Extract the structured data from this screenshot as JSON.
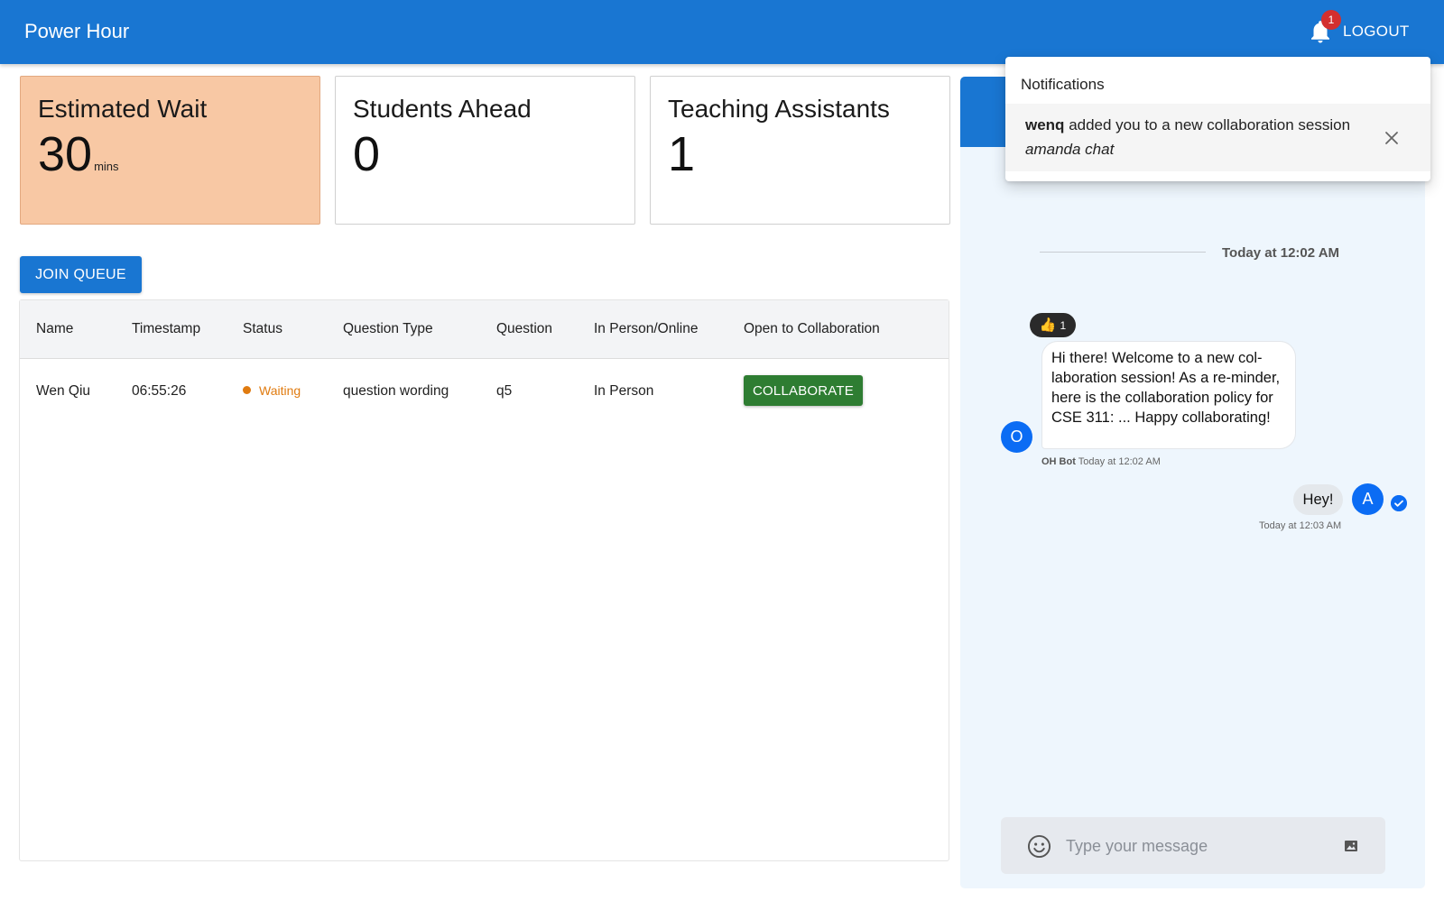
{
  "app": {
    "title": "Power Hour"
  },
  "header": {
    "notification_count": "1",
    "logout_label": "LOGOUT"
  },
  "stats": {
    "wait": {
      "title": "Estimated Wait",
      "value": "30",
      "unit": "mins"
    },
    "ahead": {
      "title": "Students Ahead",
      "value": "0"
    },
    "tas": {
      "title": "Teaching Assistants",
      "value": "1"
    }
  },
  "queue": {
    "join_label": "JOIN QUEUE",
    "columns": [
      "Name",
      "Timestamp",
      "Status",
      "Question Type",
      "Question",
      "In Person/Online",
      "Open to Collaboration"
    ],
    "rows": [
      {
        "name": "Wen Qiu",
        "timestamp": "06:55:26",
        "status": "Waiting",
        "question_type": "question wording",
        "question": "q5",
        "mode": "In Person",
        "collab_label": "COLLABORATE"
      }
    ]
  },
  "chat": {
    "date_separator": "Today at 12:02 AM",
    "messages": [
      {
        "avatar": "O",
        "reaction_count": "1",
        "text": "Hi there! Welcome to a new col-laboration session! As a re-minder, here is the collaboration policy for CSE 311: ... Happy collaborating!",
        "sender": "OH Bot",
        "time": "Today at 12:02 AM"
      },
      {
        "avatar": "A",
        "text": "Hey!",
        "time": "Today at 12:03 AM"
      }
    ],
    "input_placeholder": "Type your message"
  },
  "notifications": {
    "title": "Notifications",
    "items": [
      {
        "actor": "wenq",
        "text": "added you to a new collaboration session",
        "session": "amanda chat"
      }
    ]
  },
  "colors": {
    "primary": "#1976d2",
    "wait_card": "#f8c8a4",
    "collab": "#2e7d32",
    "waiting": "#e07b10",
    "badge": "#d32f2f"
  }
}
